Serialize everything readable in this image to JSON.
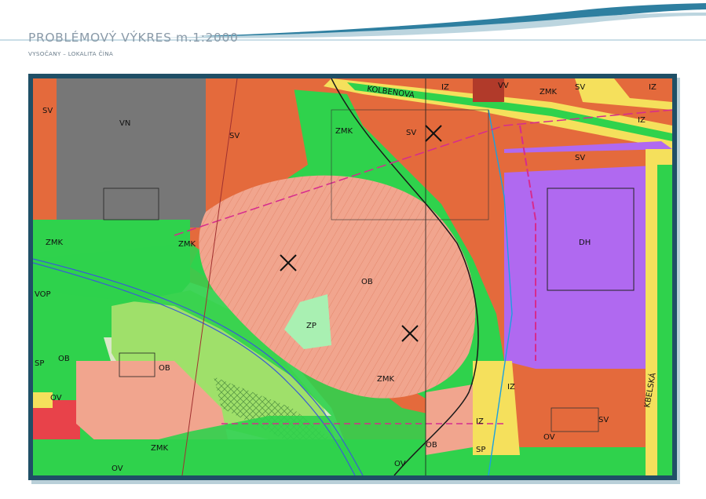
{
  "header": {
    "title": "PROBLÉMOVÝ VÝKRES m.1:2000",
    "subtitle": "VYSOČANY – LOKALITA ČÍNA"
  },
  "colors": {
    "header_wave": "#2e7fa0",
    "map_border": "#1f4f66",
    "zone_sv": "#e46a3c",
    "zone_vn": "#777777",
    "zone_zmk": "#3fd85a",
    "zone_ob": "#f1a58e",
    "zone_zp": "#a9f0b2",
    "zone_dh": "#b069f0",
    "zone_iz_sp": "#f5e05c",
    "zone_ov": "#e8424a"
  },
  "map": {
    "labels": [
      {
        "text": "SV"
      },
      {
        "text": "VN"
      },
      {
        "text": "SV"
      },
      {
        "text": "ZMK"
      },
      {
        "text": "KOLBENOVA"
      },
      {
        "text": "IZ"
      },
      {
        "text": "VV"
      },
      {
        "text": "ZMK"
      },
      {
        "text": "SV"
      },
      {
        "text": "IZ"
      },
      {
        "text": "IZ"
      },
      {
        "text": "SV"
      },
      {
        "text": "SV"
      },
      {
        "text": "ZMK"
      },
      {
        "text": "ZMK"
      },
      {
        "text": "DH"
      },
      {
        "text": "OB"
      },
      {
        "text": "VOP"
      },
      {
        "text": "ZP"
      },
      {
        "text": "OB"
      },
      {
        "text": "OB"
      },
      {
        "text": "SP"
      },
      {
        "text": "ZMK"
      },
      {
        "text": "OV"
      },
      {
        "text": "IZ"
      },
      {
        "text": "IZ"
      },
      {
        "text": "OB"
      },
      {
        "text": "SP"
      },
      {
        "text": "OV"
      },
      {
        "text": "SV"
      },
      {
        "text": "KBELSKÁ"
      },
      {
        "text": "ZMK"
      },
      {
        "text": "OV"
      },
      {
        "text": "OV"
      }
    ]
  }
}
